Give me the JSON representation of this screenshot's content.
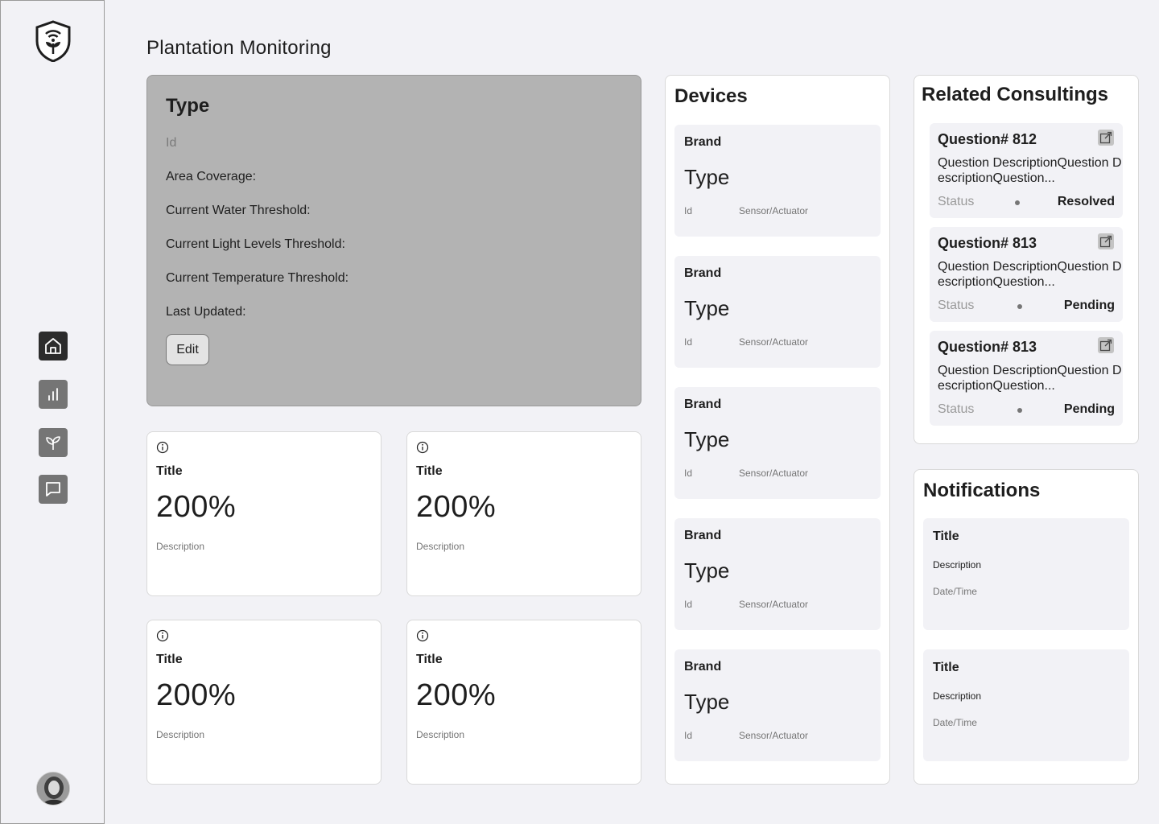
{
  "header": {
    "title": "Plantation Monitoring"
  },
  "sidebar": {
    "logo_icon": "shield-plant-wifi-icon",
    "items": [
      {
        "name": "home",
        "icon": "home-icon",
        "active": true
      },
      {
        "name": "analytics",
        "icon": "bar-chart-icon",
        "active": false
      },
      {
        "name": "plants",
        "icon": "sprout-icon",
        "active": false
      },
      {
        "name": "messages",
        "icon": "chat-icon",
        "active": false
      }
    ]
  },
  "type_panel": {
    "title": "Type",
    "id_label": "Id",
    "area_coverage": "Area Coverage:",
    "water_threshold": "Current Water Threshold:",
    "light_threshold": "Current Light Levels Threshold:",
    "temperature_threshold": "Current Temperature Threshold:",
    "last_updated": "Last Updated:",
    "edit_label": "Edit"
  },
  "stats": [
    {
      "title": "Title",
      "value": "200%",
      "description": "Description"
    },
    {
      "title": "Title",
      "value": "200%",
      "description": "Description"
    },
    {
      "title": "Title",
      "value": "200%",
      "description": "Description"
    },
    {
      "title": "Title",
      "value": "200%",
      "description": "Description"
    }
  ],
  "devices": {
    "title": "Devices",
    "items": [
      {
        "brand": "Brand",
        "type": "Type",
        "id": "Id",
        "kind": "Sensor/Actuator"
      },
      {
        "brand": "Brand",
        "type": "Type",
        "id": "Id",
        "kind": "Sensor/Actuator"
      },
      {
        "brand": "Brand",
        "type": "Type",
        "id": "Id",
        "kind": "Sensor/Actuator"
      },
      {
        "brand": "Brand",
        "type": "Type",
        "id": "Id",
        "kind": "Sensor/Actuator"
      },
      {
        "brand": "Brand",
        "type": "Type",
        "id": "Id",
        "kind": "Sensor/Actuator"
      }
    ]
  },
  "consultings": {
    "title": "Related Consultings",
    "items": [
      {
        "title": "Question# 812",
        "description": "Question DescriptionQuestion DescriptionQuestion...",
        "status_label": "Status",
        "status": "Resolved"
      },
      {
        "title": "Question# 813",
        "description": "Question DescriptionQuestion DescriptionQuestion...",
        "status_label": "Status",
        "status": "Pending"
      },
      {
        "title": "Question# 813",
        "description": "Question DescriptionQuestion DescriptionQuestion...",
        "status_label": "Status",
        "status": "Pending"
      }
    ]
  },
  "notifications": {
    "title": "Notifications",
    "items": [
      {
        "title": "Title",
        "description": "Description",
        "datetime": "Date/Time"
      },
      {
        "title": "Title",
        "description": "Description",
        "datetime": "Date/Time"
      }
    ]
  }
}
